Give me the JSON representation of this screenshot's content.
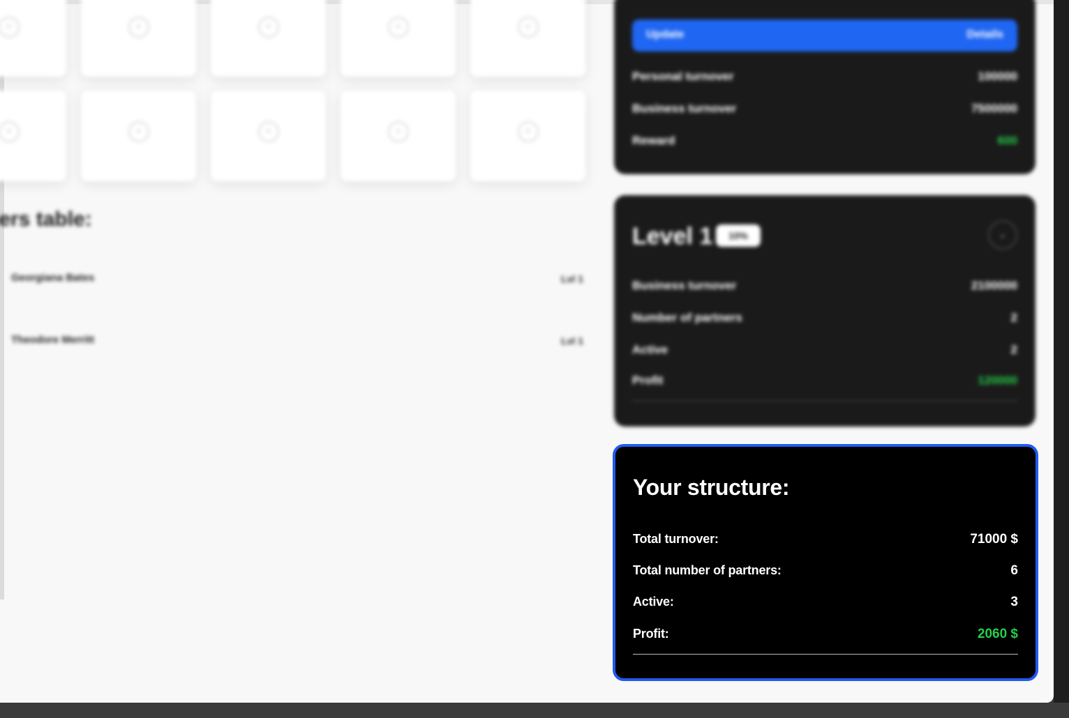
{
  "partners_section": {
    "title": "ners table:",
    "rows": [
      {
        "name": "Georgiana Bates",
        "level": "Lvl 1"
      },
      {
        "name": "Theodore Merritt",
        "level": "Lvl 1"
      }
    ]
  },
  "summary_card": {
    "update_label": "Update",
    "update_action": "Details",
    "rows": [
      {
        "label": "Personal turnover",
        "value": "100000"
      },
      {
        "label": "Business turnover",
        "value": "7500000"
      },
      {
        "label": "Reward",
        "value": "600"
      }
    ]
  },
  "level_card": {
    "title": "Level 1",
    "badge": "10%",
    "rows": [
      {
        "label": "Business turnover",
        "value": "2100000"
      },
      {
        "label": "Number of partners",
        "value": "2"
      },
      {
        "label": "Active",
        "value": "2"
      },
      {
        "label": "Profit",
        "value": "120000"
      }
    ]
  },
  "structure": {
    "title": "Your structure:",
    "total_turnover_label": "Total turnover:",
    "total_turnover_value": "71000 $",
    "total_partners_label": "Total number of partners:",
    "total_partners_value": "6",
    "active_label": "Active:",
    "active_value": "3",
    "profit_label": "Profit:",
    "profit_value": "2060 $"
  },
  "colors": {
    "accent": "#1f5bf0",
    "profit": "#22d04a",
    "card": "#1a1a1a"
  }
}
